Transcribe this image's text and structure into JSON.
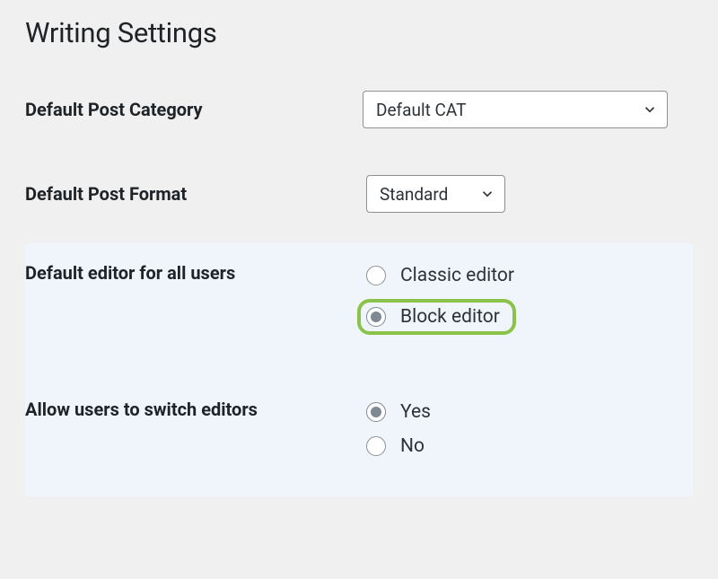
{
  "page_title": "Writing Settings",
  "category": {
    "label": "Default Post Category",
    "selected": "Default CAT"
  },
  "format": {
    "label": "Default Post Format",
    "selected": "Standard"
  },
  "default_editor": {
    "label": "Default editor for all users",
    "options": {
      "classic": "Classic editor",
      "block": "Block editor"
    },
    "selected": "block"
  },
  "allow_switch": {
    "label": "Allow users to switch editors",
    "options": {
      "yes": "Yes",
      "no": "No"
    },
    "selected": "yes"
  }
}
